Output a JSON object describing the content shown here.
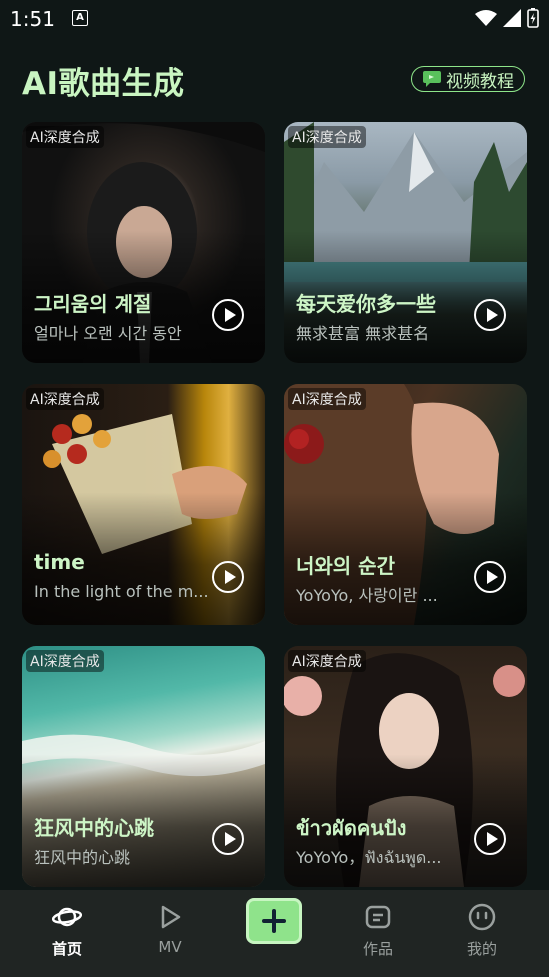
{
  "status": {
    "time": "1:51",
    "notif_letter": "A"
  },
  "header": {
    "title": "AI歌曲生成",
    "video_button": "视频教程"
  },
  "cards": [
    {
      "tag": "AI深度合成",
      "title": "그리움의 계절",
      "subtitle": "얼마나 오랜 시간 동안"
    },
    {
      "tag": "AI深度合成",
      "title": "每天爱你多一些",
      "subtitle": "無求甚富 無求甚名"
    },
    {
      "tag": "AI深度合成",
      "title": "time",
      "subtitle": "In the light of the m..."
    },
    {
      "tag": "AI深度合成",
      "title": "너와의 순간",
      "subtitle": "YoYoYo, 사랑이란 ..."
    },
    {
      "tag": "AI深度合成",
      "title": "狂风中的心跳",
      "subtitle": "狂风中的心跳"
    },
    {
      "tag": "AI深度合成",
      "title": "ข้าวผัดคนปัง",
      "subtitle": "YoYoYo，ฟังฉันพูด..."
    }
  ],
  "nav": {
    "home": "首页",
    "mv": "MV",
    "works": "作品",
    "me": "我的"
  },
  "colors": {
    "accent": "#8fe38b",
    "title_green": "#c9f5c1",
    "background": "#0f1716"
  }
}
